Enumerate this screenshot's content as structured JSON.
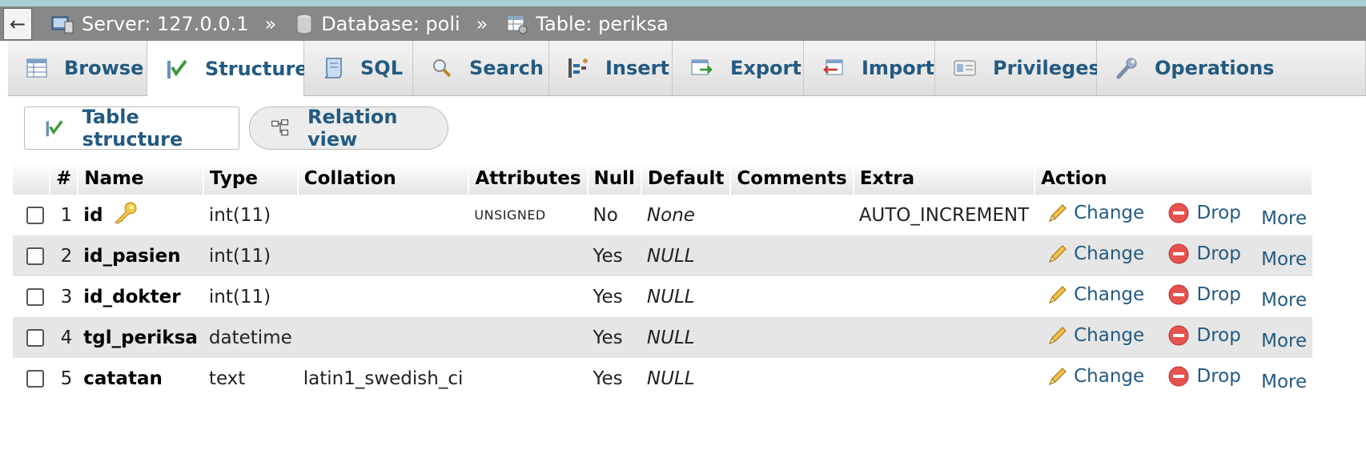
{
  "breadcrumb": {
    "back": "←",
    "server": "Server: 127.0.0.1",
    "database": "Database: poli",
    "table": "Table: periksa",
    "sep": "»"
  },
  "tabs": [
    {
      "label": "Browse",
      "icon": "browse-icon"
    },
    {
      "label": "Structure",
      "icon": "structure-icon",
      "active": true
    },
    {
      "label": "SQL",
      "icon": "sql-icon"
    },
    {
      "label": "Search",
      "icon": "search-icon"
    },
    {
      "label": "Insert",
      "icon": "insert-icon"
    },
    {
      "label": "Export",
      "icon": "export-icon"
    },
    {
      "label": "Import",
      "icon": "import-icon"
    },
    {
      "label": "Privileges",
      "icon": "privileges-icon"
    },
    {
      "label": "Operations",
      "icon": "operations-icon"
    }
  ],
  "subtabs": {
    "table_structure": "Table structure",
    "relation_view": "Relation view"
  },
  "columns": [
    "#",
    "Name",
    "Type",
    "Collation",
    "Attributes",
    "Null",
    "Default",
    "Comments",
    "Extra",
    "Action"
  ],
  "rows": [
    {
      "num": "1",
      "name": "id",
      "type": "int(11)",
      "collation": "",
      "attributes": "UNSIGNED",
      "null": "No",
      "default": "None",
      "comments": "",
      "extra": "AUTO_INCREMENT",
      "primary_key": true
    },
    {
      "num": "2",
      "name": "id_pasien",
      "type": "int(11)",
      "collation": "",
      "attributes": "",
      "null": "Yes",
      "default": "NULL",
      "comments": "",
      "extra": ""
    },
    {
      "num": "3",
      "name": "id_dokter",
      "type": "int(11)",
      "collation": "",
      "attributes": "",
      "null": "Yes",
      "default": "NULL",
      "comments": "",
      "extra": ""
    },
    {
      "num": "4",
      "name": "tgl_periksa",
      "type": "datetime",
      "collation": "",
      "attributes": "",
      "null": "Yes",
      "default": "NULL",
      "comments": "",
      "extra": ""
    },
    {
      "num": "5",
      "name": "catatan",
      "type": "text",
      "collation": "latin1_swedish_ci",
      "attributes": "",
      "null": "Yes",
      "default": "NULL",
      "comments": "",
      "extra": ""
    }
  ],
  "actions": {
    "change": "Change",
    "drop": "Drop",
    "more": "More"
  },
  "colors": {
    "link": "#235a81",
    "header_bar": "#888888",
    "row_alt": "#e6e6e6"
  }
}
